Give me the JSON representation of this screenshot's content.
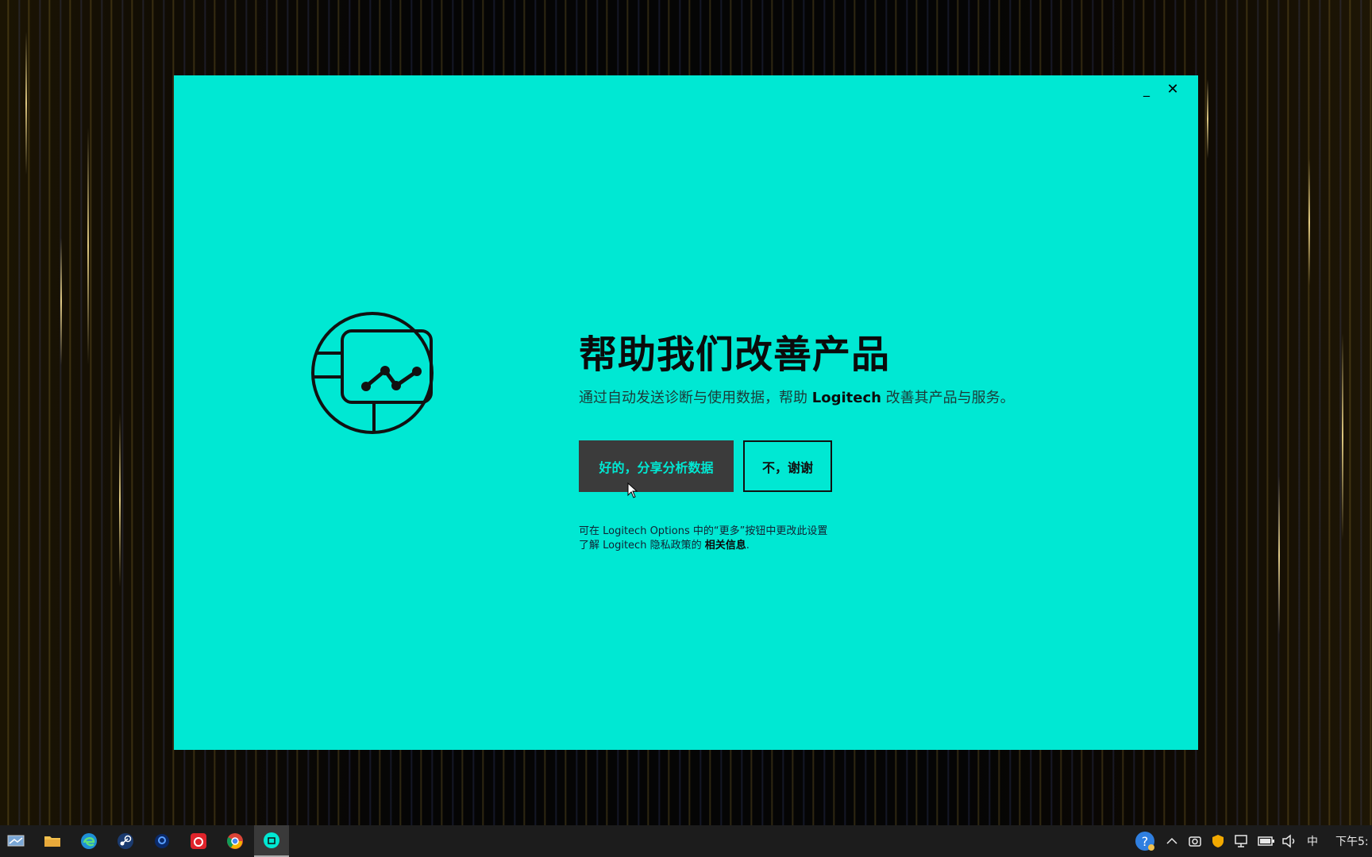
{
  "window": {
    "minimize_glyph": "_",
    "close_glyph": "✕"
  },
  "dialog": {
    "illustration_icon": "analytics-monitor-icon",
    "title": "帮助我们改善产品",
    "subtitle_pre": "通过自动发送诊断与使用数据，帮助 ",
    "subtitle_brand": "Logitech",
    "subtitle_post": " 改善其产品与服务。",
    "accept_label": "好的，分享分析数据",
    "decline_label": "不，谢谢",
    "note_line1": "可在 Logitech Options 中的“更多”按钮中更改此设置",
    "note_line2_pre": "了解 Logitech 隐私政策的 ",
    "note_line2_link": "相关信息",
    "note_line2_post": "."
  },
  "taskbar": {
    "apps": [
      {
        "name": "show-desktop-icon"
      },
      {
        "name": "file-explorer-icon"
      },
      {
        "name": "edge-icon"
      },
      {
        "name": "steam-icon"
      },
      {
        "name": "app-blue-icon"
      },
      {
        "name": "netease-music-icon"
      },
      {
        "name": "chrome-icon"
      },
      {
        "name": "logitech-options-icon"
      }
    ],
    "tray": {
      "ime": "中",
      "clock": "下午5:"
    }
  },
  "colors": {
    "dialog_bg": "#00e8d3",
    "accept_bg": "#3b3b3b",
    "accept_text": "#00e8d3"
  }
}
